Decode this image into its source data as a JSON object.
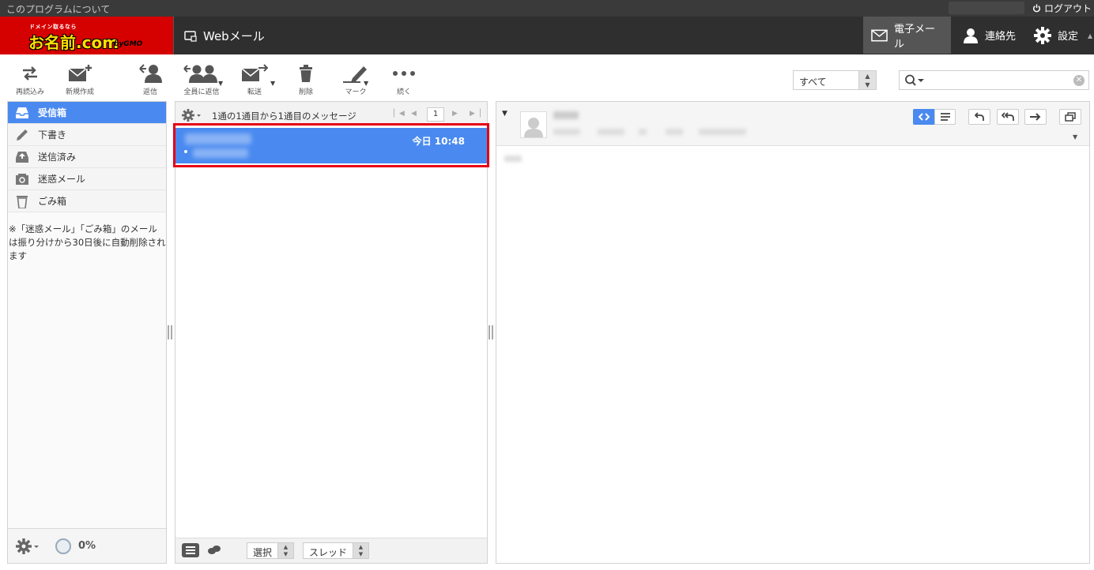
{
  "topbar": {
    "about": "このプログラムについて",
    "logout": "ログアウト"
  },
  "header": {
    "logo_small": "ドメイン取るなら",
    "logo_main": "お名前.com",
    "logo_gmo": "byGMO",
    "app_title": "Webメール",
    "nav_mail": "電子メール",
    "nav_contacts": "連絡先",
    "nav_settings": "設定"
  },
  "toolbar": {
    "refresh": "再読込み",
    "compose": "新規作成",
    "reply": "返信",
    "reply_all": "全員に返信",
    "forward": "転送",
    "delete": "削除",
    "mark": "マーク",
    "more": "続く",
    "filter_value": "すべて",
    "search_placeholder": ""
  },
  "folders": {
    "items": [
      {
        "label": "受信箱",
        "icon": "inbox-icon",
        "active": true
      },
      {
        "label": "下書き",
        "icon": "pencil-icon",
        "active": false
      },
      {
        "label": "送信済み",
        "icon": "sent-icon",
        "active": false
      },
      {
        "label": "迷惑メール",
        "icon": "spam-icon",
        "active": false
      },
      {
        "label": "ごみ箱",
        "icon": "trash-icon",
        "active": false
      }
    ],
    "note": "※「迷惑メール」「ごみ箱」のメールは振り分けから30日後に自動削除されます",
    "quota": "0%"
  },
  "message_list": {
    "count_text": "1通の1通目から1通目のメッセージ",
    "page": "1",
    "messages": [
      {
        "date": "今日 10:48",
        "selected": true
      }
    ],
    "select_label": "選択",
    "thread_label": "スレッド"
  },
  "colors": {
    "accent": "#4a8af0",
    "brand_red": "#d50000",
    "highlight": "#e60012"
  }
}
